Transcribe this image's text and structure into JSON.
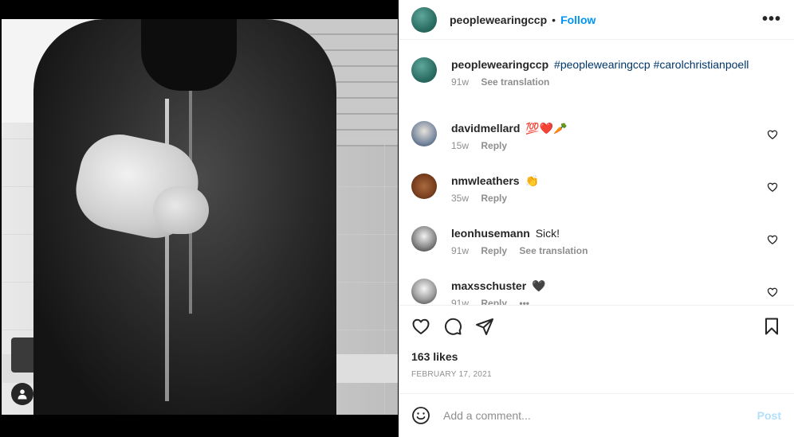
{
  "post": {
    "author": "peoplewearingccp",
    "follow_label": "Follow",
    "separator": "•",
    "more_label": "•••"
  },
  "comments": [
    {
      "user": "peoplewearingccp",
      "text": "",
      "tags": "#peoplewearingccp #carolchristianpoell",
      "time": "91w",
      "action1": "See translation",
      "action2": "",
      "likeable": false
    },
    {
      "user": "davidmellard",
      "text": "💯❤️🥕",
      "tags": "",
      "time": "15w",
      "action1": "Reply",
      "action2": "",
      "likeable": true
    },
    {
      "user": "nmwleathers",
      "text": "👏",
      "tags": "",
      "time": "35w",
      "action1": "Reply",
      "action2": "",
      "likeable": true
    },
    {
      "user": "leonhusemann",
      "text": "Sick!",
      "tags": "",
      "time": "91w",
      "action1": "Reply",
      "action2": "See translation",
      "likeable": true
    },
    {
      "user": "maxsschuster",
      "text": "🖤",
      "tags": "",
      "time": "91w",
      "action1": "Reply",
      "action2": "•••",
      "likeable": true
    }
  ],
  "stats": {
    "likes": "163 likes",
    "date": "FEBRUARY 17, 2021"
  },
  "composer": {
    "placeholder": "Add a comment...",
    "post_label": "Post"
  },
  "icons": {
    "like": "heart-icon",
    "comment": "comment-icon",
    "share": "share-icon",
    "save": "bookmark-icon",
    "emoji": "emoji-icon",
    "tagged_people": "user-icon"
  },
  "colors": {
    "follow": "#0095f6",
    "hashtag": "#00376b",
    "post_disabled": "#b2dffc",
    "muted": "#8e8e8e"
  }
}
